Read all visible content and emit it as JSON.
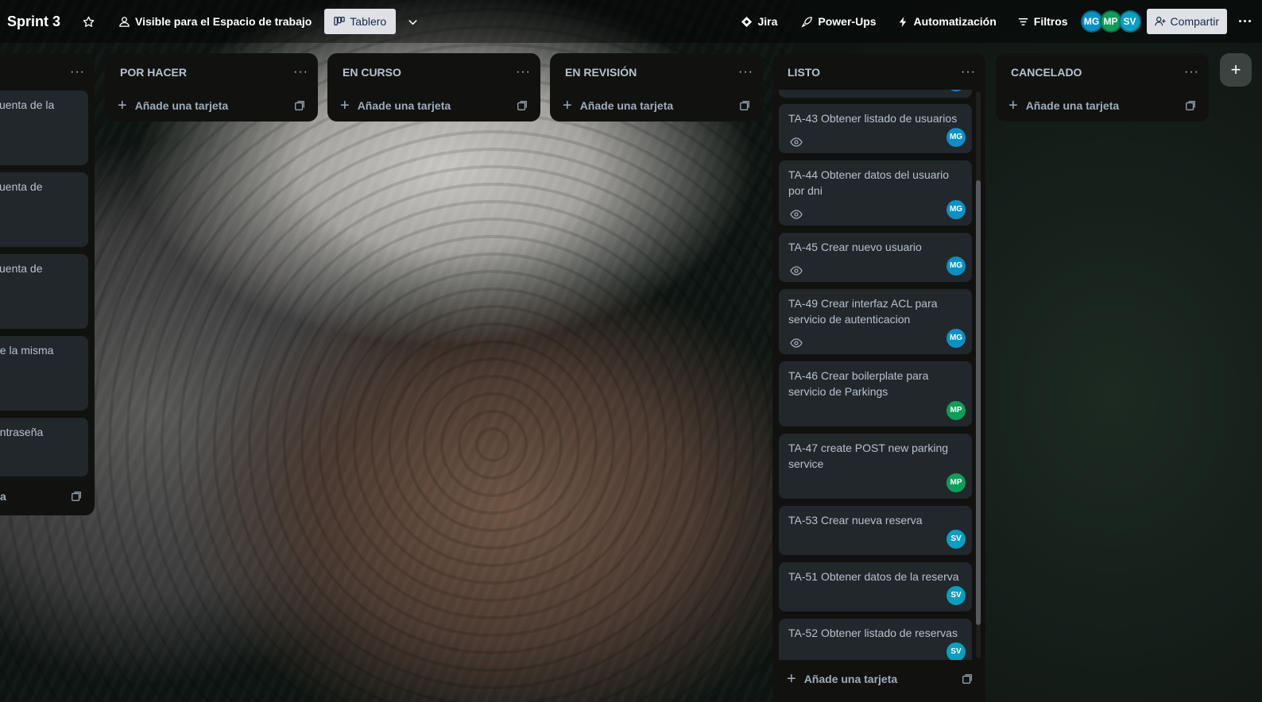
{
  "header": {
    "board_title": "Sprint 3",
    "visibility_label": "Visible para el Espacio de trabajo",
    "view_label": "Tablero",
    "jira_label": "Jira",
    "powerups_label": "Power-Ups",
    "automation_label": "Automatización",
    "filters_label": "Filtros",
    "share_label": "Compartir",
    "members": [
      "MG",
      "MP",
      "SV"
    ]
  },
  "partial_list": {
    "cards": [
      {
        "text": "cuenta de la"
      },
      {
        "text": "cuenta de"
      },
      {
        "text": "cuenta de"
      },
      {
        "text": "de la misma"
      },
      {
        "text": "ontraseña"
      }
    ],
    "add_text": "a"
  },
  "lists": [
    {
      "title": "POR HACER",
      "add_label": "Añade una tarjeta"
    },
    {
      "title": "EN CURSO",
      "add_label": "Añade una tarjeta"
    },
    {
      "title": "EN REVISIÓN",
      "add_label": "Añade una tarjeta"
    }
  ],
  "listo": {
    "title": "LISTO",
    "add_label": "Añade una tarjeta",
    "cards": [
      {
        "text": "TA-43 Obtener listado de usuarios",
        "watch": true,
        "member": "MG"
      },
      {
        "text": "TA-44 Obtener datos del usuario por dni",
        "watch": true,
        "member": "MG"
      },
      {
        "text": "TA-45 Crear nuevo usuario",
        "watch": true,
        "member": "MG"
      },
      {
        "text": "TA-49 Crear interfaz ACL para servicio de autenticacion",
        "watch": true,
        "member": "MG"
      },
      {
        "text": "TA-46 Crear boilerplate para servicio de Parkings",
        "watch": false,
        "member": "MP"
      },
      {
        "text": "TA-47 create POST new parking service",
        "watch": false,
        "member": "MP"
      },
      {
        "text": "TA-53 Crear nueva reserva",
        "watch": false,
        "member": "SV"
      },
      {
        "text": "TA-51 Obtener datos de la reserva",
        "watch": false,
        "member": "SV"
      },
      {
        "text": "TA-52 Obtener listado de reservas",
        "watch": false,
        "member": "SV"
      }
    ]
  },
  "cancelado": {
    "title": "CANCELADO",
    "add_label": "Añade una tarjeta"
  },
  "more_glyph": "···",
  "add_list_glyph": "+"
}
